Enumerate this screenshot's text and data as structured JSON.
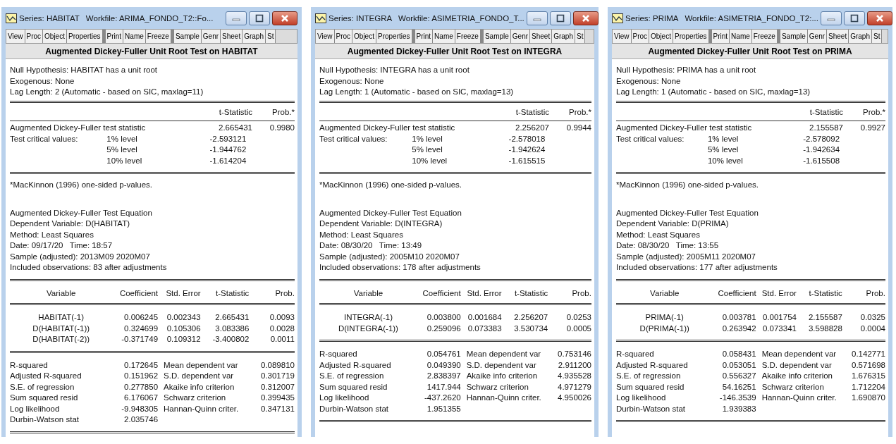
{
  "windows": [
    {
      "title": "Series: HABITAT",
      "workfile": "Workfile: ARIMA_FONDO_T2::Fo...",
      "toolbar": [
        [
          "View",
          "Proc",
          "Object",
          "Properties"
        ],
        [
          "Print",
          "Name",
          "Freeze"
        ],
        [
          "Sample",
          "Genr",
          "Sheet",
          "Graph",
          "St"
        ]
      ],
      "heading": "Augmented Dickey-Fuller Unit Root Test on HABITAT",
      "info": [
        "Null Hypothesis: HABITAT has a unit root",
        "Exogenous: None",
        "Lag Length: 2 (Automatic - based on SIC, maxlag=11)"
      ],
      "test_header": [
        "t-Statistic",
        "Prob.*"
      ],
      "adf": {
        "label": "Augmented Dickey-Fuller test statistic",
        "t": "2.665431",
        "prob": "0.9980"
      },
      "critical": {
        "label": "Test critical values:",
        "levels": [
          {
            "level": "1% level",
            "value": "-2.593121"
          },
          {
            "level": "5% level",
            "value": "-1.944762"
          },
          {
            "level": "10% level",
            "value": "-1.614204"
          }
        ]
      },
      "footnote": "*MacKinnon (1996) one-sided p-values.",
      "equation": [
        "Augmented Dickey-Fuller Test Equation",
        "Dependent Variable: D(HABITAT)",
        "Method: Least Squares",
        "Date: 09/17/20   Time: 18:57",
        "Sample (adjusted): 2013M09 2020M07",
        "Included observations: 83 after adjustments"
      ],
      "columns": [
        "Variable",
        "Coefficient",
        "Std. Error",
        "t-Statistic",
        "Prob."
      ],
      "rows": [
        [
          "HABITAT(-1)",
          "0.006245",
          "0.002343",
          "2.665431",
          "0.0093"
        ],
        [
          "D(HABITAT(-1))",
          "0.324699",
          "0.105306",
          "3.083386",
          "0.0028"
        ],
        [
          "D(HABITAT(-2))",
          "-0.371749",
          "0.109312",
          "-3.400802",
          "0.0011"
        ]
      ],
      "stats": [
        [
          "R-squared",
          "0.172645",
          "Mean dependent var",
          "0.089810"
        ],
        [
          "Adjusted R-squared",
          "0.151962",
          "S.D. dependent var",
          "0.301719"
        ],
        [
          "S.E. of regression",
          "0.277850",
          "Akaike info criterion",
          "0.312007"
        ],
        [
          "Sum squared resid",
          "6.176067",
          "Schwarz criterion",
          "0.399435"
        ],
        [
          "Log likelihood",
          "-9.948305",
          "Hannan-Quinn criter.",
          "0.347131"
        ],
        [
          "Durbin-Watson stat",
          "2.035746"
        ]
      ]
    },
    {
      "title": "Series: INTEGRA",
      "workfile": "Workfile: ASIMETRIA_FONDO_T...",
      "toolbar": [
        [
          "View",
          "Proc",
          "Object",
          "Properties"
        ],
        [
          "Print",
          "Name",
          "Freeze"
        ],
        [
          "Sample",
          "Genr",
          "Sheet",
          "Graph",
          "St"
        ]
      ],
      "heading": "Augmented Dickey-Fuller Unit Root Test on INTEGRA",
      "info": [
        "Null Hypothesis: INTEGRA has a unit root",
        "Exogenous: None",
        "Lag Length: 1 (Automatic - based on SIC, maxlag=13)"
      ],
      "test_header": [
        "t-Statistic",
        "Prob.*"
      ],
      "adf": {
        "label": "Augmented Dickey-Fuller test statistic",
        "t": "2.256207",
        "prob": "0.9944"
      },
      "critical": {
        "label": "Test critical values:",
        "levels": [
          {
            "level": "1% level",
            "value": "-2.578018"
          },
          {
            "level": "5% level",
            "value": "-1.942624"
          },
          {
            "level": "10% level",
            "value": "-1.615515"
          }
        ]
      },
      "footnote": "*MacKinnon (1996) one-sided p-values.",
      "equation": [
        "Augmented Dickey-Fuller Test Equation",
        "Dependent Variable: D(INTEGRA)",
        "Method: Least Squares",
        "Date: 08/30/20   Time: 13:49",
        "Sample (adjusted): 2005M10 2020M07",
        "Included observations: 178 after adjustments"
      ],
      "columns": [
        "Variable",
        "Coefficient",
        "Std. Error",
        "t-Statistic",
        "Prob."
      ],
      "rows": [
        [
          "INTEGRA(-1)",
          "0.003800",
          "0.001684",
          "2.256207",
          "0.0253"
        ],
        [
          "D(INTEGRA(-1))",
          "0.259096",
          "0.073383",
          "3.530734",
          "0.0005"
        ]
      ],
      "stats": [
        [
          "R-squared",
          "0.054761",
          "Mean dependent var",
          "0.753146"
        ],
        [
          "Adjusted R-squared",
          "0.049390",
          "S.D. dependent var",
          "2.911200"
        ],
        [
          "S.E. of regression",
          "2.838397",
          "Akaike info criterion",
          "4.935528"
        ],
        [
          "Sum squared resid",
          "1417.944",
          "Schwarz criterion",
          "4.971279"
        ],
        [
          "Log likelihood",
          "-437.2620",
          "Hannan-Quinn criter.",
          "4.950026"
        ],
        [
          "Durbin-Watson stat",
          "1.951355"
        ]
      ]
    },
    {
      "title": "Series: PRIMA",
      "workfile": "Workfile: ASIMETRIA_FONDO_T2:...",
      "toolbar": [
        [
          "View",
          "Proc",
          "Object",
          "Properties"
        ],
        [
          "Print",
          "Name",
          "Freeze"
        ],
        [
          "Sample",
          "Genr",
          "Sheet",
          "Graph",
          "St"
        ]
      ],
      "heading": "Augmented Dickey-Fuller Unit Root Test on PRIMA",
      "info": [
        "Null Hypothesis: PRIMA has a unit root",
        "Exogenous: None",
        "Lag Length: 1 (Automatic - based on SIC, maxlag=13)"
      ],
      "test_header": [
        "t-Statistic",
        "Prob.*"
      ],
      "adf": {
        "label": "Augmented Dickey-Fuller test statistic",
        "t": "2.155587",
        "prob": "0.9927"
      },
      "critical": {
        "label": "Test critical values:",
        "levels": [
          {
            "level": "1% level",
            "value": "-2.578092"
          },
          {
            "level": "5% level",
            "value": "-1.942634"
          },
          {
            "level": "10% level",
            "value": "-1.615508"
          }
        ]
      },
      "footnote": "*MacKinnon (1996) one-sided p-values.",
      "equation": [
        "Augmented Dickey-Fuller Test Equation",
        "Dependent Variable: D(PRIMA)",
        "Method: Least Squares",
        "Date: 08/30/20   Time: 13:55",
        "Sample (adjusted): 2005M11 2020M07",
        "Included observations: 177 after adjustments"
      ],
      "columns": [
        "Variable",
        "Coefficient",
        "Std. Error",
        "t-Statistic",
        "Prob."
      ],
      "rows": [
        [
          "PRIMA(-1)",
          "0.003781",
          "0.001754",
          "2.155587",
          "0.0325"
        ],
        [
          "D(PRIMA(-1))",
          "0.263942",
          "0.073341",
          "3.598828",
          "0.0004"
        ]
      ],
      "stats": [
        [
          "R-squared",
          "0.058431",
          "Mean dependent var",
          "0.142771"
        ],
        [
          "Adjusted R-squared",
          "0.053051",
          "S.D. dependent var",
          "0.571698"
        ],
        [
          "S.E. of regression",
          "0.556327",
          "Akaike info criterion",
          "1.676315"
        ],
        [
          "Sum squared resid",
          "54.16251",
          "Schwarz criterion",
          "1.712204"
        ],
        [
          "Log likelihood",
          "-146.3539",
          "Hannan-Quinn criter.",
          "1.690870"
        ],
        [
          "Durbin-Watson stat",
          "1.939383"
        ]
      ]
    }
  ]
}
